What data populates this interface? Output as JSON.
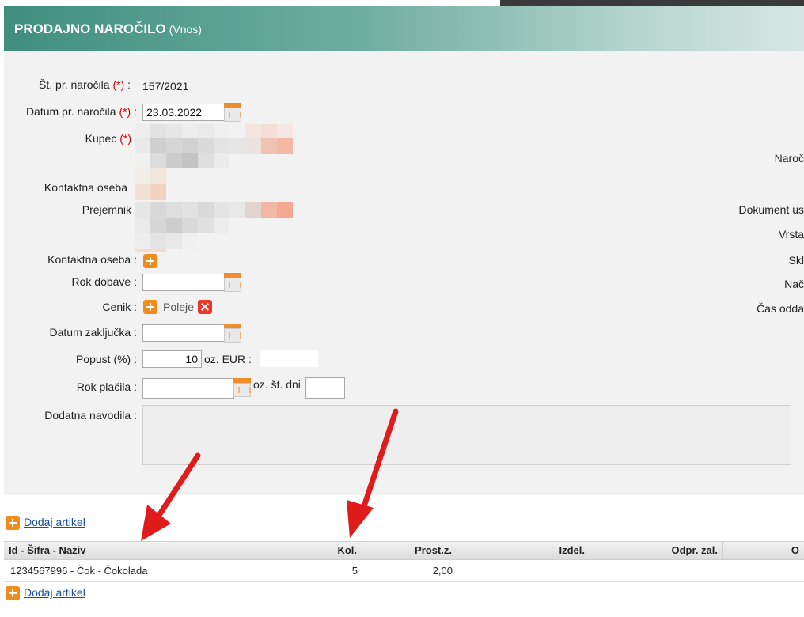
{
  "header": {
    "title": "PRODAJNO NAROČILO",
    "subtitle": "(Vnos)"
  },
  "required_marker": "(*)",
  "form": {
    "order_no": {
      "label": "Št. pr. naročila",
      "value": "157/2021"
    },
    "order_date": {
      "label": "Datum pr. naročila",
      "value": "23.03.2022"
    },
    "customer": {
      "label": "Kupec"
    },
    "contact1": {
      "label": "Kontaktna oseba"
    },
    "recipient": {
      "label": "Prejemnik"
    },
    "contact2": {
      "label": "Kontaktna oseba"
    },
    "delivery": {
      "label": "Rok dobave :",
      "value": ""
    },
    "pricelist": {
      "label": "Cenik :",
      "value": "Poleje"
    },
    "close_date": {
      "label": "Datum zaključka :",
      "value": ""
    },
    "discount": {
      "label": "Popust (%) :",
      "value": "10",
      "eur_label": "oz. EUR :",
      "eur_value": ""
    },
    "payment": {
      "label": "Rok plačila :",
      "value": "",
      "days_label": "oz. št. dni",
      "days_value": ""
    },
    "notes": {
      "label": "Dodatna navodila :"
    }
  },
  "right_labels": [
    "Naroč",
    "Dokument us",
    "Vrsta",
    "Skl",
    "Nač",
    "Čas odda"
  ],
  "items": {
    "add_label": "Dodaj artikel",
    "columns": [
      "Id - Šifra - Naziv",
      "Kol.",
      "Prost.z.",
      "Izdel.",
      "Odpr. zal.",
      "O"
    ],
    "rows": [
      {
        "name": "1234567996 - Čok - Čokolada",
        "qty": "5",
        "free": "2,00",
        "made": "",
        "open": "",
        "other": ""
      }
    ]
  },
  "colors": {
    "accent": "#3f8f7c",
    "arrow": "#e01b1b",
    "link": "#1a4f99",
    "plus": "#f18b1c"
  }
}
